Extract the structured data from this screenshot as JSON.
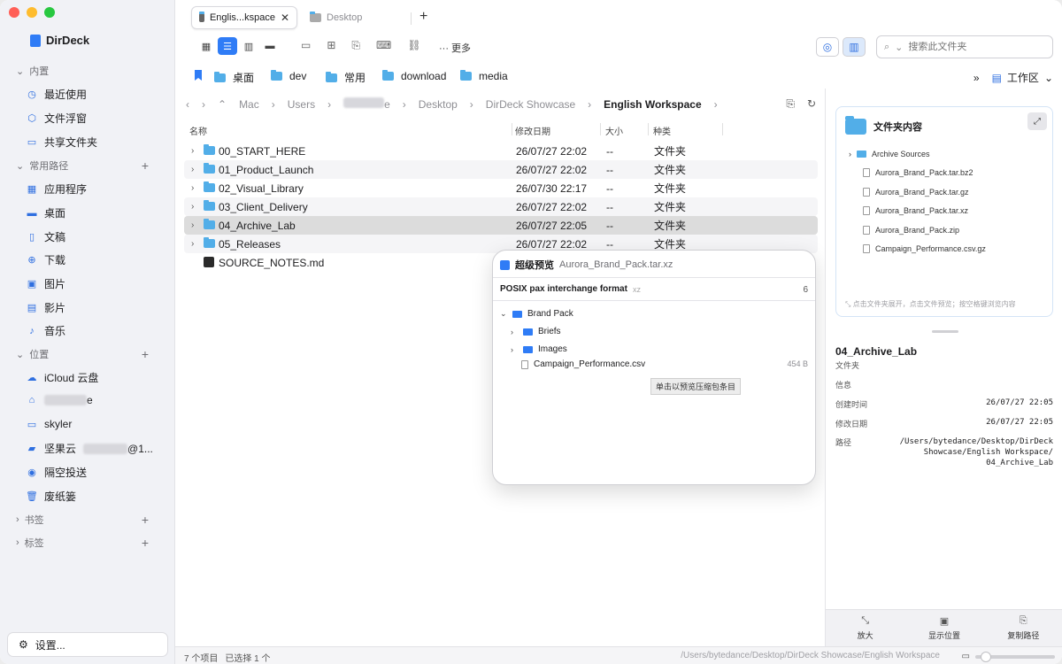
{
  "app": {
    "title": "DirDeck"
  },
  "colors": {
    "accent": "#2f7cf6",
    "folder": "#52aee8",
    "selected_row": "#dcdcdc"
  },
  "sidebar": {
    "sections": {
      "builtin": "内置",
      "paths": "常用路径",
      "locations": "位置",
      "bookmarks": "书签",
      "tags": "标签"
    },
    "builtin_items": [
      {
        "label": "最近使用",
        "icon": "clock-icon"
      },
      {
        "label": "文件浮窗",
        "icon": "cube-icon"
      },
      {
        "label": "共享文件夹",
        "icon": "shared-folder-icon"
      }
    ],
    "path_items": [
      {
        "label": "应用程序",
        "icon": "apps-icon"
      },
      {
        "label": "桌面",
        "icon": "desktop-icon"
      },
      {
        "label": "文稿",
        "icon": "document-icon"
      },
      {
        "label": "下载",
        "icon": "download-icon"
      },
      {
        "label": "图片",
        "icon": "photo-icon"
      },
      {
        "label": "影片",
        "icon": "film-icon"
      },
      {
        "label": "音乐",
        "icon": "music-icon"
      }
    ],
    "location_items": [
      {
        "label": "iCloud 云盘",
        "icon": "cloud-icon"
      },
      {
        "label": "e",
        "icon": "home-icon"
      },
      {
        "label": "skyler",
        "icon": "computer-icon"
      },
      {
        "label": "坚果云",
        "suffix": "@1...",
        "icon": "drive-icon"
      },
      {
        "label": "隔空投送",
        "icon": "airdrop-icon"
      },
      {
        "label": "废纸篓",
        "icon": "trash-icon"
      }
    ],
    "settings": "设置..."
  },
  "tabs": [
    {
      "label": "Englis...kspace",
      "active": true
    },
    {
      "label": "Desktop",
      "active": false
    }
  ],
  "toolbar": {
    "more": "更多",
    "search_placeholder": "搜索此文件夹"
  },
  "bookmarks": [
    {
      "label": "桌面"
    },
    {
      "label": "dev"
    },
    {
      "label": "常用"
    },
    {
      "label": "download"
    },
    {
      "label": "media"
    }
  ],
  "workspace_label": "工作区",
  "breadcrumbs": [
    "Mac",
    "Users",
    "e",
    "Desktop",
    "DirDeck Showcase",
    "English Workspace"
  ],
  "columns": {
    "name": "名称",
    "date": "修改日期",
    "size": "大小",
    "kind": "种类"
  },
  "files": [
    {
      "name": "00_START_HERE",
      "date": "26/07/27 22:02",
      "size": "--",
      "kind": "文件夹"
    },
    {
      "name": "01_Product_Launch",
      "date": "26/07/27 22:02",
      "size": "--",
      "kind": "文件夹"
    },
    {
      "name": "02_Visual_Library",
      "date": "26/07/30 22:17",
      "size": "--",
      "kind": "文件夹"
    },
    {
      "name": "03_Client_Delivery",
      "date": "26/07/27 22:02",
      "size": "--",
      "kind": "文件夹"
    },
    {
      "name": "04_Archive_Lab",
      "date": "26/07/27 22:05",
      "size": "--",
      "kind": "文件夹"
    },
    {
      "name": "05_Releases",
      "date": "26/07/27 22:02",
      "size": "--",
      "kind": "文件夹"
    },
    {
      "name": "SOURCE_NOTES.md",
      "date": "",
      "size": "",
      "kind": ""
    }
  ],
  "preview": {
    "title": "超级预览",
    "file": "Aurora_Brand_Pack.tar.xz",
    "format": "POSIX pax interchange format",
    "format_ext": "xz",
    "count": "6",
    "tree": [
      {
        "label": "Brand Pack"
      },
      {
        "label": "Briefs"
      },
      {
        "label": "Images"
      },
      {
        "label": "Campaign_Performance.csv",
        "size": "454 B"
      }
    ],
    "tooltip": "单击以预览压缩包条目"
  },
  "right_panel": {
    "card_title": "文件夹内容",
    "items": [
      "Archive Sources",
      "Aurora_Brand_Pack.tar.bz2",
      "Aurora_Brand_Pack.tar.gz",
      "Aurora_Brand_Pack.tar.xz",
      "Aurora_Brand_Pack.zip",
      "Campaign_Performance.csv.gz"
    ],
    "hint": "点击文件夹展开，点击文件预览；按空格键浏览内容",
    "selected_name": "04_Archive_Lab",
    "selected_kind": "文件夹",
    "info_header": "信息",
    "created_label": "创建时间",
    "created_value": "26/07/27 22:05",
    "modified_label": "修改日期",
    "modified_value": "26/07/27 22:05",
    "path_label": "路径",
    "path_value": "/Users/bytedance/Desktop/DirDeck Showcase/English Workspace/ 04_Archive_Lab",
    "actions": {
      "zoom": "放大",
      "show": "显示位置",
      "copy_path": "复制路径"
    }
  },
  "status": {
    "items": "7 个项目",
    "selected": "已选择 1 个",
    "path": "/Users/bytedance/Desktop/DirDeck Showcase/English Workspace"
  }
}
